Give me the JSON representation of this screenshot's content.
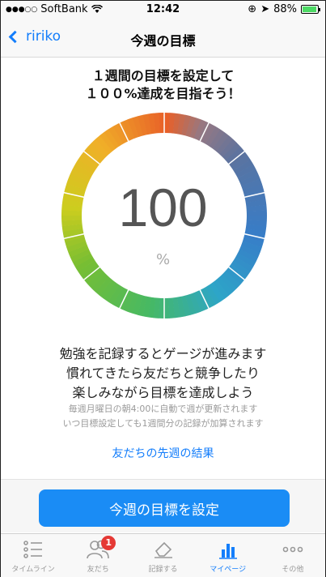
{
  "status": {
    "carrier": "SoftBank",
    "time": "12:42",
    "battery": "88%"
  },
  "nav": {
    "back_label": "ririko",
    "title": "今週の目標"
  },
  "headline": {
    "line1": "１週間の目標を設定して",
    "line2": "１００%達成を目指そう！"
  },
  "gauge": {
    "value": "100",
    "unit": "%",
    "fill_fraction": 1.0
  },
  "description": {
    "line1": "勉強を記録するとゲージが進みます",
    "line2": "慣れてきたら友だちと競争したり",
    "line3": "楽しみながら目標を達成しよう"
  },
  "note": {
    "line1": "毎週月曜日の朝4:00に自動で週が更新されます",
    "line2": "いつ目標設定しても1週間分の記録が加算されます"
  },
  "friends_link": "友だちの先週の結果",
  "cta_label": "今週の目標を設定",
  "tabs": [
    {
      "label": "タイムライン",
      "icon": "list-icon"
    },
    {
      "label": "友だち",
      "icon": "friends-icon",
      "badge": "1"
    },
    {
      "label": "記録する",
      "icon": "eraser-icon"
    },
    {
      "label": "マイページ",
      "icon": "bar-chart-icon",
      "active": true
    },
    {
      "label": "その他",
      "icon": "more-icon"
    }
  ],
  "colors": {
    "accent": "#147efb",
    "cta": "#1a8cf5",
    "badge": "#e53935"
  }
}
